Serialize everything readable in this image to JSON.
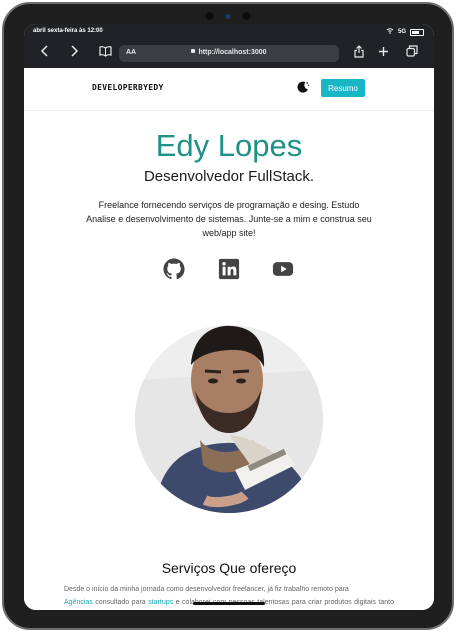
{
  "status_bar": {
    "time": "abril sexta-feira às 12:00",
    "network": "5G"
  },
  "browser": {
    "aa_label": "AA",
    "url": "http://localhost:3000"
  },
  "navbar": {
    "logo": "DEVELOPERBYEDY",
    "resume_button": "Resumo"
  },
  "hero": {
    "name": "Edy Lopes",
    "role": "Desenvolvedor FullStack.",
    "description": "Freelance fornecendo serviços de programação e desing. Estudo Analise e desenvolvimento de sistemas. Junte-se a mim e construa seu web/app site!"
  },
  "services": {
    "title": "Serviços Que ofereço",
    "text_1": "Desde o início da minha jornada como desenvolvedor freelancer, já fiz trabalho remoto para",
    "link_1": "Agências",
    "text_2": " consultado para ",
    "link_2": "startups",
    "text_3": " e colaborei com pessoas talentosas para criar produtos digitais tanto para uso comercial quanto para o consumidor final."
  },
  "colors": {
    "accent": "#1f9187",
    "button": "#19b6c6",
    "link": "#19a7b6",
    "browser_bar": "#202225"
  },
  "icons": [
    "back-icon",
    "forward-icon",
    "book-icon",
    "lock-icon",
    "share-icon",
    "plus-icon",
    "tabs-icon",
    "moon-icon",
    "github-icon",
    "linkedin-icon",
    "youtube-icon"
  ]
}
